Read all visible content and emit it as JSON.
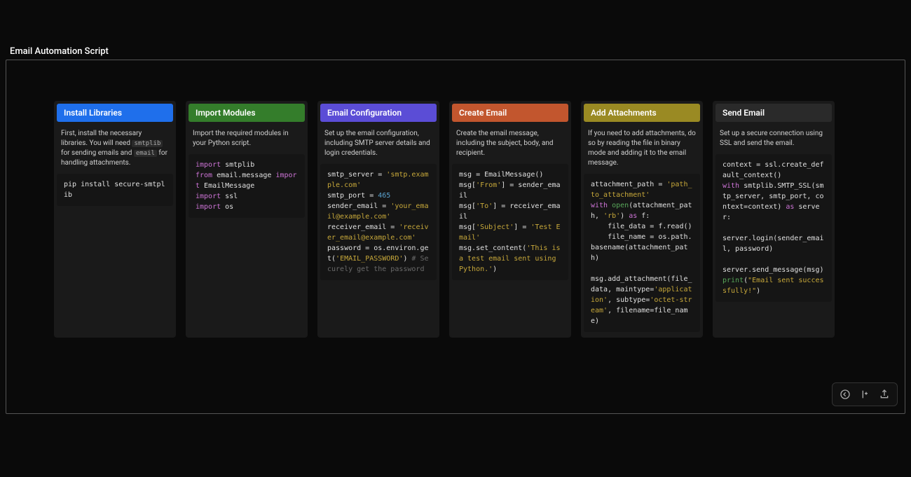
{
  "page_title": "Email Automation Script",
  "columns": [
    {
      "id": "install",
      "title": "Install Libraries",
      "header_class": "hdr-blue",
      "desc_html": "First, install the necessary libraries. You will need <code>smtplib</code> for sending emails and <code>email</code> for handling attachments.",
      "code_html": "pip install secure-smtplib"
    },
    {
      "id": "import",
      "title": "Import Modules",
      "header_class": "hdr-green",
      "desc_html": "Import the required modules in your Python script.",
      "code_html": "<span class=\"tok-kw\">import</span> smtplib\n<span class=\"tok-kw\">from</span> email.message <span class=\"tok-kw\">import</span> EmailMessage\n<span class=\"tok-kw\">import</span> ssl\n<span class=\"tok-kw\">import</span> os"
    },
    {
      "id": "config",
      "title": "Email Configuration",
      "header_class": "hdr-purple",
      "desc_html": "Set up the email configuration, including SMTP server details and login credentials.",
      "code_html": "smtp_server = <span class=\"tok-str\">'smtp.example.com'</span>\nsmtp_port = <span class=\"tok-num\">465</span>\nsender_email = <span class=\"tok-str\">'your_email@example.com'</span>\nreceiver_email = <span class=\"tok-str\">'receiver_email@example.com'</span>\npassword = os.environ.get(<span class=\"tok-str\">'EMAIL_PASSWORD'</span>) <span class=\"tok-cmt\"># Securely get the password</span>"
    },
    {
      "id": "create",
      "title": "Create Email",
      "header_class": "hdr-orange",
      "desc_html": "Create the email message, including the subject, body, and recipient.",
      "code_html": "msg = EmailMessage()\nmsg[<span class=\"tok-str\">'From'</span>] = sender_email\nmsg[<span class=\"tok-str\">'To'</span>] = receiver_email\nmsg[<span class=\"tok-str\">'Subject'</span>] = <span class=\"tok-str\">'Test Email'</span>\nmsg.set_content(<span class=\"tok-str\">'This is a test email sent using Python.'</span>)"
    },
    {
      "id": "attach",
      "title": "Add Attachments",
      "header_class": "hdr-olive",
      "desc_html": "If you need to add attachments, do so by reading the file in binary mode and adding it to the email message.",
      "code_html": "attachment_path = <span class=\"tok-str\">'path_to_attachment'</span>\n<span class=\"tok-kw\">with</span> <span class=\"tok-fn\">open</span>(attachment_path, <span class=\"tok-str\">'rb'</span>) <span class=\"tok-kw\">as</span> f:\n    file_data = f.read()\n    file_name = os.path.basename(attachment_path)\n\nmsg.add_attachment(file_data, maintype=<span class=\"tok-str\">'application'</span>, subtype=<span class=\"tok-str\">'octet-stream'</span>, filename=file_name)"
    },
    {
      "id": "send",
      "title": "Send Email",
      "header_class": "hdr-dark",
      "desc_html": "Set up a secure connection using SSL and send the email.",
      "code_html": "context = ssl.create_default_context()\n<span class=\"tok-kw\">with</span> smtplib.SMTP_SSL(smtp_server, smtp_port, context=context) <span class=\"tok-kw\">as</span> server:\n\nserver.login(sender_email, password)\n\nserver.send_message(msg)\n<span class=\"tok-fn\">print</span>(<span class=\"tok-str\">\"Email sent successfully!\"</span>)"
    }
  ],
  "toolbar": {
    "back": "back",
    "insert": "insert",
    "share": "share"
  }
}
